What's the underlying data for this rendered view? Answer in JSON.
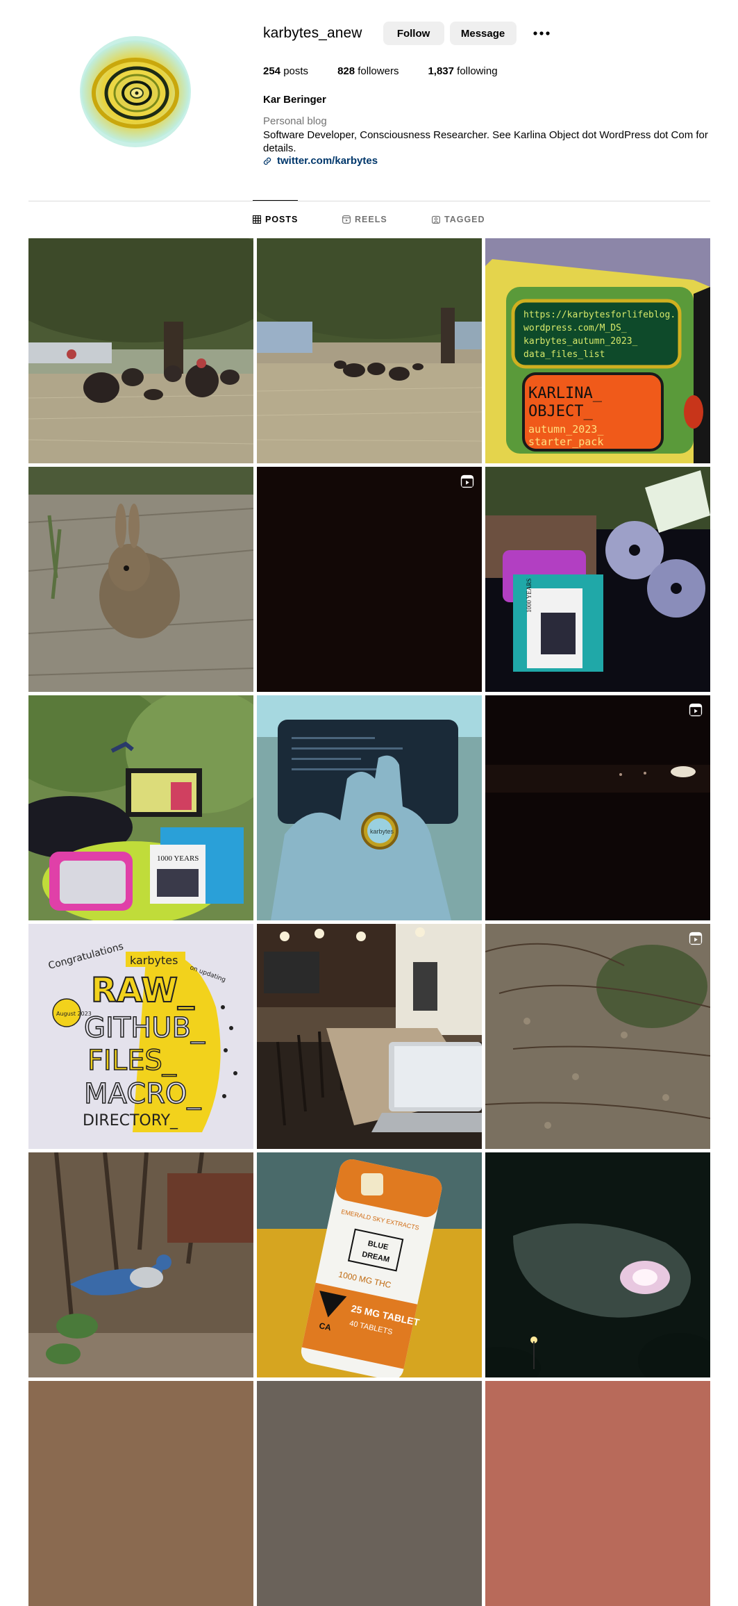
{
  "profile": {
    "username": "karbytes_anew",
    "follow_label": "Follow",
    "message_label": "Message",
    "more_icon": "more-options-icon",
    "posts_count": "254",
    "posts_label": " posts",
    "followers_count": "828",
    "followers_label": " followers",
    "following_count": "1,837",
    "following_label": " following",
    "full_name": "Kar Beringer",
    "category": "Personal blog",
    "bio": "Software Developer, Consciousness Researcher. See Karlina Object dot WordPress dot Com for details.",
    "link_text": "twitter.com/karbytes",
    "link_icon": "link-icon"
  },
  "tabs": [
    {
      "label": "POSTS",
      "icon": "grid-icon",
      "active": true
    },
    {
      "label": "REELS",
      "icon": "reels-icon",
      "active": false
    },
    {
      "label": "TAGGED",
      "icon": "tagged-icon",
      "active": false
    }
  ],
  "posts": [
    {
      "subject": "turkeys under tree",
      "reel": false
    },
    {
      "subject": "turkeys in dry field",
      "reel": false
    },
    {
      "subject": "colorful handwritten sign",
      "reel": false
    },
    {
      "subject": "rabbit on dirt",
      "reel": false
    },
    {
      "subject": "dark video",
      "reel": true
    },
    {
      "subject": "discs and notebooks",
      "reel": false
    },
    {
      "subject": "laptop outdoors with tin",
      "reel": false
    },
    {
      "subject": "bottle cap in hand",
      "reel": false
    },
    {
      "subject": "night scene",
      "reel": true
    },
    {
      "subject": "hand-drawn poster",
      "reel": false
    },
    {
      "subject": "restaurant interior with laptop",
      "reel": false
    },
    {
      "subject": "brush and dry leaves",
      "reel": true
    },
    {
      "subject": "blue jay in brush",
      "reel": false
    },
    {
      "subject": "tablet tin on yellow fabric",
      "reel": false
    },
    {
      "subject": "moon behind clouds at night",
      "reel": false
    }
  ],
  "poster_text": {
    "congrats": "Congratulations",
    "name": "karbytes",
    "updating": "on updating",
    "date": "August 2023",
    "raw": "RAW_",
    "github": "GITHUB_",
    "files": "FILES_",
    "macro": "MACRO_",
    "directory": "DIRECTORY_"
  },
  "sign_text": {
    "url1": "https://karbytesforlifeblog.",
    "url2": "wordpress.com/M_DS_",
    "url3": "karbytes_autumn_2023_",
    "url4": "data_files_list",
    "title1": "KARLINA_",
    "title2": "OBJECT_",
    "sub1": "autumn_2023_",
    "sub2": "starter_pack"
  },
  "book_text": "1000 YEARS",
  "tin_text": {
    "brand": "EMERALD SKY EXTRACTS",
    "flavor1": "BLUE",
    "flavor2": "DREAM",
    "thc": "1000 MG THC",
    "dose": "25 MG TABLET",
    "count": "40 TABLETS",
    "state": "CA"
  },
  "cap_text": "karbytes",
  "colors": {
    "link": "#00376b",
    "button_bg": "#efefef",
    "muted": "#737373",
    "divider": "#dbdbdb"
  }
}
